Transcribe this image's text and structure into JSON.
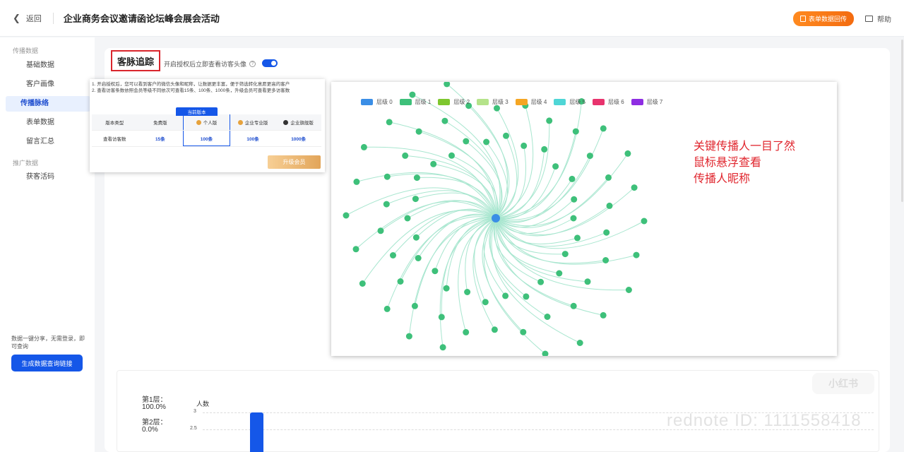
{
  "header": {
    "back_label": "返回",
    "page_title": "企业商务会议邀请函论坛峰会展会活动",
    "form_data_button": "表单数据回传",
    "help_label": "帮助"
  },
  "sidebar": {
    "group1": "传播数据",
    "items1": [
      "基础数据",
      "客户画像",
      "传播脉络",
      "表单数据",
      "留言汇总"
    ],
    "group2": "推广数据",
    "items2": [
      "获客活码"
    ],
    "note": "数据一键分享，无需登录，即可查询",
    "generate_button": "生成数据查询链接"
  },
  "section": {
    "title": "客脉追踪",
    "auth_text": "开启授权后立即查看访客头像",
    "help_mark": "?"
  },
  "popup": {
    "note1": "1. 开启授权后，您可以看到客户的微信头像和昵称，让数据更丰富，便于筛选转化意愿更高的客户",
    "note2": "2. 查看访客条数依照会员等级不同依次可查看15条、100条、1000条，升级会员可查看更多访客数",
    "current_tag": "当前版本",
    "headers": [
      "版本类型",
      "免费版",
      "个人版",
      "企业专业版",
      "企业旗舰版"
    ],
    "row_label": "查看访客数",
    "values": [
      "15条",
      "100条",
      "100条",
      "1000条"
    ],
    "upgrade_button": "升级会员",
    "medal_colors": [
      "#e6a23c",
      "#e6a23c",
      "#333333"
    ]
  },
  "graph": {
    "legend": [
      {
        "label": "层级 0",
        "color": "#3a8ee6"
      },
      {
        "label": "层级 1",
        "color": "#3ec07a"
      },
      {
        "label": "层级 2",
        "color": "#7ec72e"
      },
      {
        "label": "层级 3",
        "color": "#b5e38a"
      },
      {
        "label": "层级 4",
        "color": "#f5a623"
      },
      {
        "label": "层级 5",
        "color": "#4fd6d6"
      },
      {
        "label": "层级 6",
        "color": "#e8336d"
      },
      {
        "label": "层级 7",
        "color": "#8e2de2"
      }
    ],
    "annotation": [
      "关键传播人一目了然",
      "鼠标悬浮查看",
      "传播人昵称"
    ],
    "node_count": 78,
    "center_color": "#3a8ee6",
    "node_color": "#3ec07a",
    "link_color": "#a8e6cf"
  },
  "distribution": {
    "layers": [
      {
        "name": "第1层：",
        "pct": "100.0%"
      },
      {
        "name": "第2层：",
        "pct": "0.0%"
      }
    ],
    "y_title": "人数",
    "y_ticks": [
      "3",
      "2.5"
    ],
    "bar_value": 3
  },
  "watermark": "rednote ID: 1111558418",
  "watermark_logo": "小红书"
}
